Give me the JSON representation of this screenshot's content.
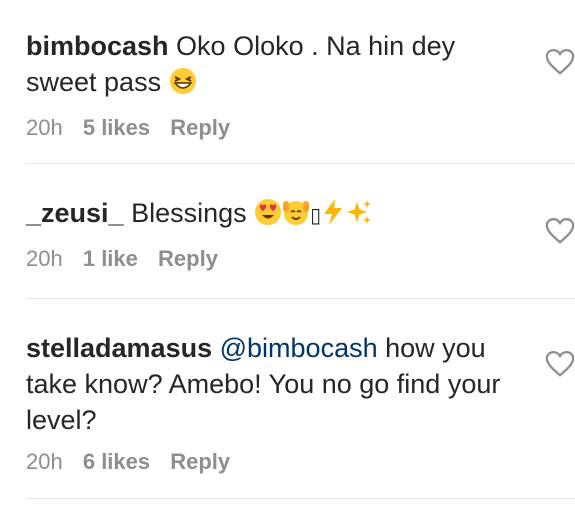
{
  "comments": [
    {
      "username": "bimbocash",
      "text": "Oko Oloko . Na hin dey sweet pass",
      "emojis": [
        "grinning-squinting-face"
      ],
      "time": "20h",
      "likes": "5 likes",
      "reply": "Reply"
    },
    {
      "username": "_zeusi_",
      "text": "Blessings",
      "emojis": [
        "heart-eyes-face",
        "raised-hands-face",
        "unknown-glyph",
        "high-voltage",
        "sparkles"
      ],
      "unknown_glyph": "▯",
      "time": "20h",
      "likes": "1 like",
      "reply": "Reply"
    },
    {
      "username": "stelladamasus",
      "mention": "@bimbocash",
      "text": "how you take know? Amebo! You no go find your level?",
      "time": "20h",
      "likes": "6 likes",
      "reply": "Reply"
    }
  ],
  "icons": {
    "like": "heart-outline-icon"
  },
  "colors": {
    "text": "#262626",
    "meta": "#8e8e8e",
    "mention": "#003569",
    "divider": "#e6e6e6",
    "emoji_yellow": "#ffcc33",
    "emoji_heart": "#e5304a",
    "bolt": "#ffb400"
  }
}
